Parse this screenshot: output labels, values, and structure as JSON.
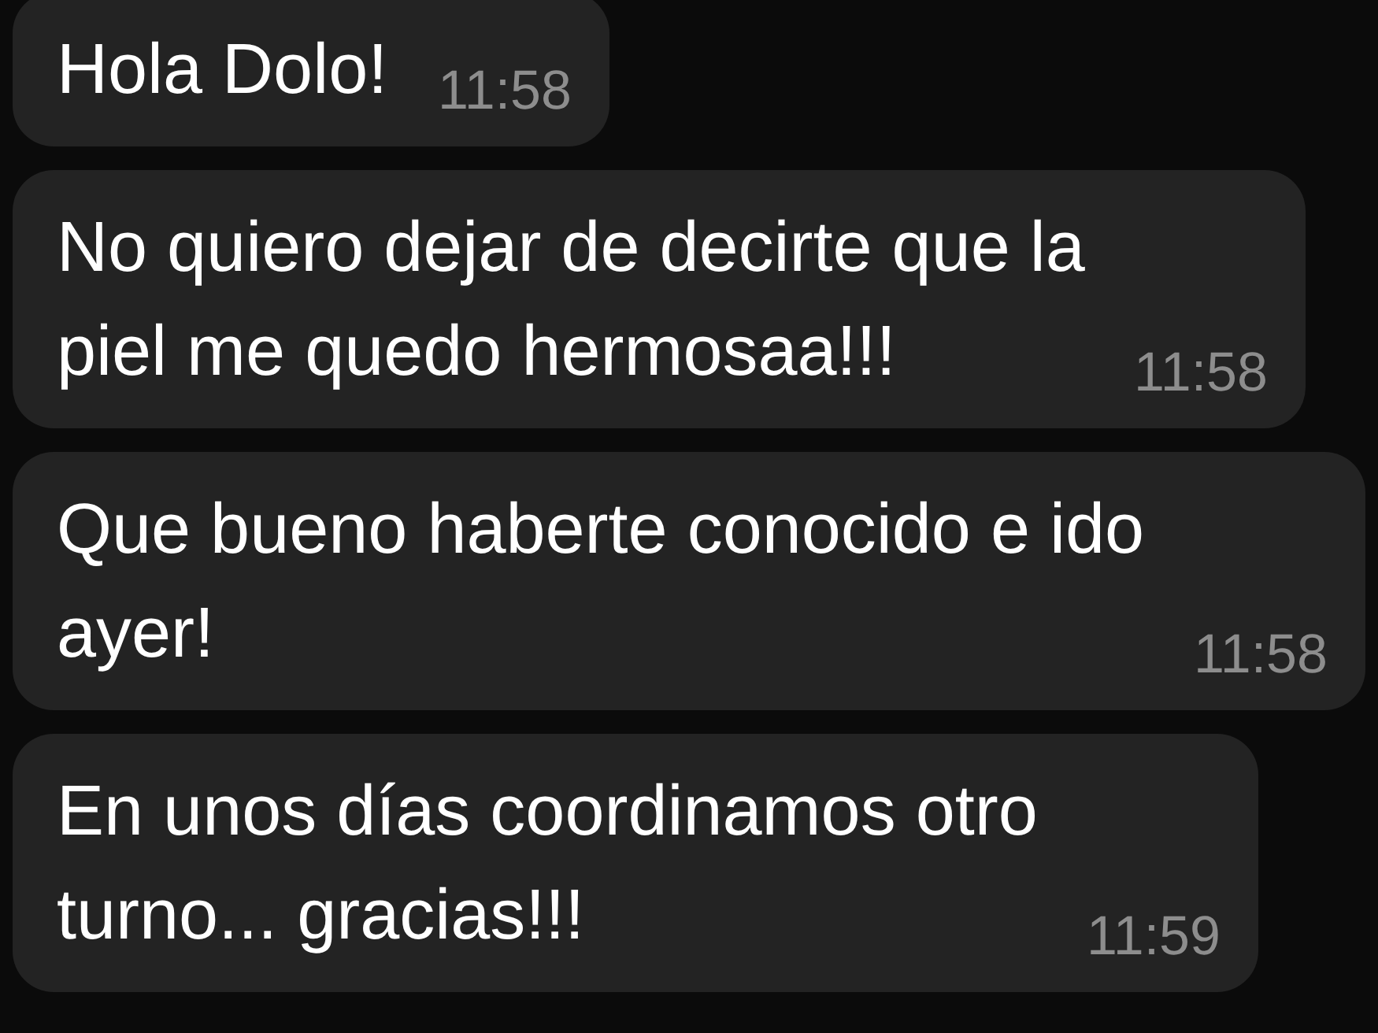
{
  "messages": [
    {
      "text": "Hola Dolo!",
      "time": "11:58"
    },
    {
      "text": "No quiero dejar de decirte que la piel me quedo hermosaa!!!",
      "time": "11:58"
    },
    {
      "text": "Que bueno haberte conocido e ido ayer!",
      "time": "11:58"
    },
    {
      "text": "En unos días coordinamos otro turno... gracias!!!",
      "time": "11:59"
    }
  ]
}
